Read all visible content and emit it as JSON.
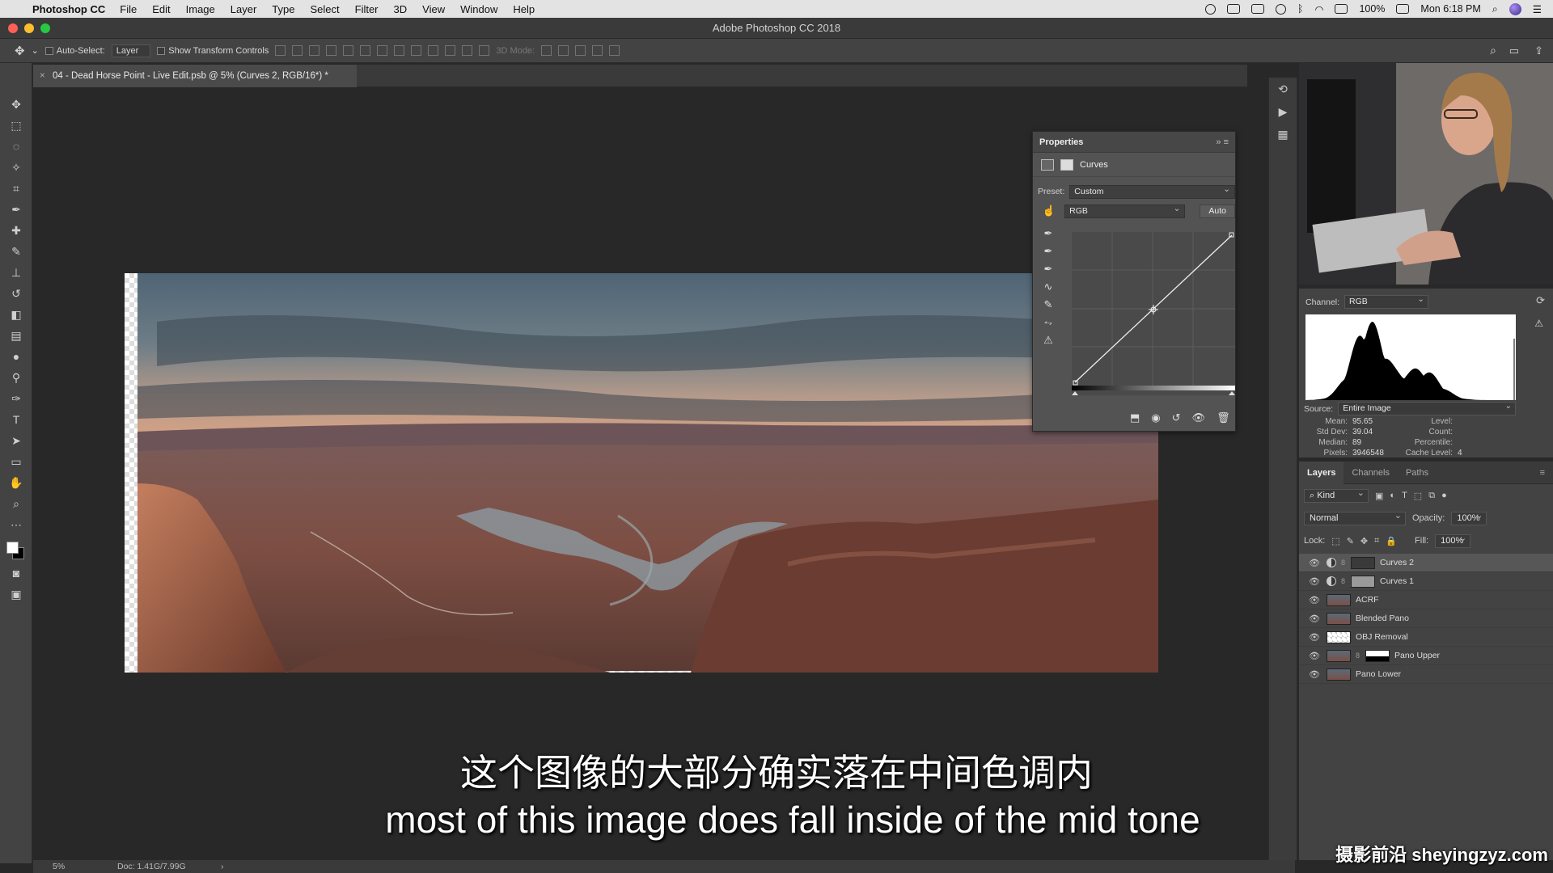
{
  "menubar": {
    "app_name": "Photoshop CC",
    "items": [
      "File",
      "Edit",
      "Image",
      "Layer",
      "Type",
      "Select",
      "Filter",
      "3D",
      "View",
      "Window",
      "Help"
    ],
    "battery": "100%",
    "clock": "Mon 6:18 PM"
  },
  "window": {
    "title": "Adobe Photoshop CC 2018",
    "traffic_colors": [
      "#ff5f57",
      "#febc2e",
      "#28c840"
    ]
  },
  "options_bar": {
    "auto_select_label": "Auto-Select:",
    "auto_select_target": "Layer",
    "show_transform_label": "Show Transform Controls",
    "mode_3d_label": "3D Mode:"
  },
  "document": {
    "tab_title": "04 - Dead Horse Point - Live Edit.psb @ 5% (Curves 2, RGB/16*) *",
    "zoom": "5%",
    "doc_size": "Doc: 1.41G/7.99G"
  },
  "properties": {
    "panel_title": "Properties",
    "adjustment_name": "Curves",
    "preset_label": "Preset:",
    "preset_value": "Custom",
    "channel_value": "RGB",
    "auto_label": "Auto"
  },
  "histogram": {
    "channel_label": "Channel:",
    "channel_value": "RGB",
    "source_label": "Source:",
    "source_value": "Entire Image",
    "stats": {
      "mean_label": "Mean:",
      "mean": "95.65",
      "std_label": "Std Dev:",
      "std": "39.04",
      "median_label": "Median:",
      "median": "89",
      "pixels_label": "Pixels:",
      "pixels": "3946548",
      "level_label": "Level:",
      "count_label": "Count:",
      "percentile_label": "Percentile:",
      "cache_label": "Cache Level:",
      "cache": "4"
    }
  },
  "layers_panel": {
    "tabs": [
      "Layers",
      "Channels",
      "Paths"
    ],
    "filter_kind": "Kind",
    "blend_mode": "Normal",
    "opacity_label": "Opacity:",
    "opacity": "100%",
    "lock_label": "Lock:",
    "fill_label": "Fill:",
    "fill": "100%",
    "layers": [
      {
        "name": "Curves 2",
        "type": "adjustment",
        "selected": true
      },
      {
        "name": "Curves 1",
        "type": "adjustment",
        "selected": false
      },
      {
        "name": "ACRF",
        "type": "pixel",
        "selected": false
      },
      {
        "name": "Blended Pano",
        "type": "pixel",
        "selected": false
      },
      {
        "name": "OBJ Removal",
        "type": "pixel",
        "selected": false
      },
      {
        "name": "Pano Upper",
        "type": "masked",
        "selected": false
      },
      {
        "name": "Pano Lower",
        "type": "pixel",
        "selected": false
      }
    ]
  },
  "subtitles": {
    "zh": "这个图像的大部分确实落在中间色调内",
    "en": "most of this image does fall inside of the mid tone"
  },
  "watermark": "摄影前沿 sheyingzyz.com",
  "icons": {
    "apple": "apple-icon",
    "tools": [
      "move-icon",
      "marquee-icon",
      "lasso-icon",
      "magic-wand-icon",
      "crop-icon",
      "eyedropper-icon",
      "healing-icon",
      "brush-icon",
      "stamp-icon",
      "history-brush-icon",
      "eraser-icon",
      "gradient-icon",
      "blur-icon",
      "dodge-icon",
      "pen-icon",
      "type-icon",
      "path-select-icon",
      "rectangle-icon",
      "hand-icon",
      "zoom-icon",
      "more-icon"
    ]
  }
}
